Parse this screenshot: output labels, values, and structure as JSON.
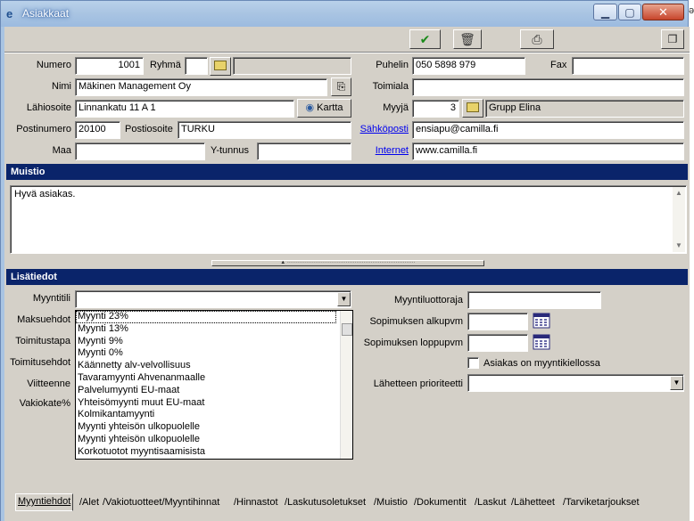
{
  "window": {
    "title": "Asiakkaat"
  },
  "header": {
    "numero_label": "Numero",
    "numero": "1001",
    "ryhma_label": "Ryhmä",
    "ryhma": "",
    "ryhma_name": "",
    "nimi_label": "Nimi",
    "nimi": "Mäkinen Management Oy",
    "lahiosoite_label": "Lähiosoite",
    "lahiosoite": "Linnankatu 11 A 1",
    "kartta_label": "Kartta",
    "postinumero_label": "Postinumero",
    "postinumero": "20100",
    "postiosoite_label": "Postiosoite",
    "postiosoite": "TURKU",
    "maa_label": "Maa",
    "maa": "",
    "ytunnus_label": "Y-tunnus",
    "ytunnus": "",
    "puhelin_label": "Puhelin",
    "puhelin": "050 5898 979",
    "fax_label": "Fax",
    "fax": "",
    "toimiala_label": "Toimiala",
    "toimiala": "",
    "myyja_label": "Myyjä",
    "myyja": "3",
    "myyja_name": "Grupp Elina",
    "sahkoposti_label": "Sähköposti",
    "sahkoposti": "ensiapu@camilla.fi",
    "internet_label": "Internet",
    "internet": "www.camilla.fi"
  },
  "muistio": {
    "header": "Muistio",
    "text": "Hyvä asiakas."
  },
  "lisatiedot": {
    "header": "Lisätiedot",
    "myyntitili_label": "Myyntitili",
    "myyntitili": "",
    "maksuehdot_label": "Maksuehdot",
    "toimitustapa_label": "Toimitustapa",
    "toimitusehdot_label": "Toimitusehdot",
    "viitteenne_label": "Viitteenne",
    "vakiokate_label": "Vakiokate%",
    "dropdown_items": [
      "Myynti 23%",
      "Myynti 13%",
      "Myynti 9%",
      "Myynti 0%",
      "Käännetty alv-velvollisuus",
      "Tavaramyynti Ahvenanmaalle",
      "Palvelumyynti EU-maat",
      "Yhteisömyynti muut EU-maat",
      "Kolmikantamyynti",
      "Myynti yhteisön ulkopuolelle",
      "Myynti yhteisön ulkopuolelle",
      "Korkotuotot myyntisaamisista"
    ],
    "myyntiluottoraja_label": "Myyntiluottoraja",
    "myyntiluottoraja": "",
    "sopimuksen_alkupvm_label": "Sopimuksen alkupvm",
    "sopimuksen_alkupvm": "",
    "sopimuksen_loppupvm_label": "Sopimuksen loppupvm",
    "sopimuksen_loppupvm": "",
    "myyntikielto_label": "Asiakas on myyntikiellossa",
    "lahetteen_prioriteetti_label": "Lähetteen prioriteetti",
    "lahetteen_prioriteetti": ""
  },
  "tabs": [
    "Myyntiehdot",
    "Alet",
    "Vakiotuotteet/Myyntihinnat",
    "Hinnastot",
    "Laskutusoletukset",
    "Muistio",
    "Dokumentit",
    "Laskut",
    "Lähetteet",
    "Tarviketarjoukset"
  ],
  "icons": {
    "accept": "check-icon",
    "delete": "trash-icon",
    "print": "printer-icon",
    "windows": "window-switch-icon",
    "folder": "folder-icon",
    "map": "map-icon",
    "calendar": "calendar-icon",
    "contact": "contact-card-icon"
  },
  "colors": {
    "section_header": "#0a246a",
    "titlebar": "#a9c4e2",
    "face": "#d4d0c8"
  }
}
